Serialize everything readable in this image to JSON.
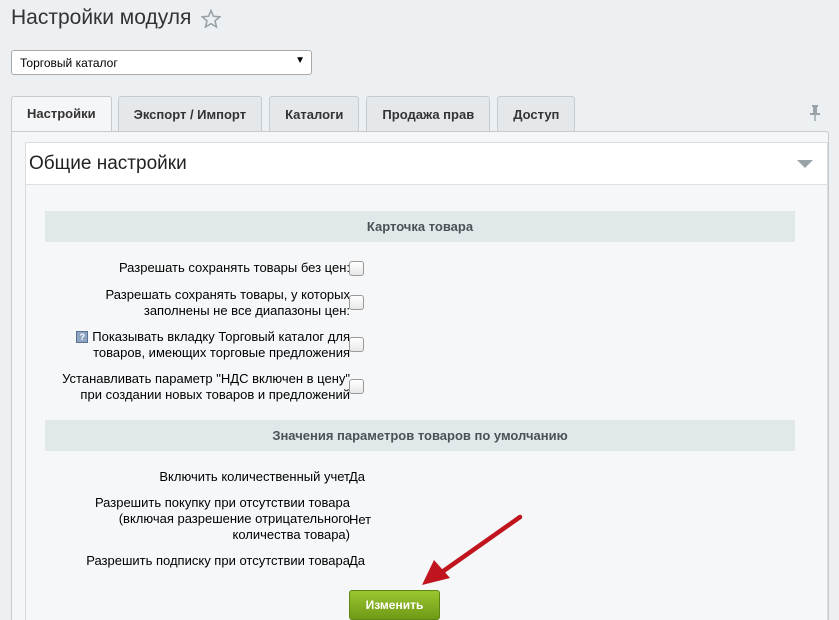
{
  "header": {
    "title": "Настройки модуля",
    "favorite_icon": "star-outline-icon"
  },
  "module_select": {
    "selected": "Торговый каталог"
  },
  "tabs": [
    {
      "label": "Настройки",
      "active": true
    },
    {
      "label": "Экспорт / Импорт",
      "active": false
    },
    {
      "label": "Каталоги",
      "active": false
    },
    {
      "label": "Продажа прав",
      "active": false
    },
    {
      "label": "Доступ",
      "active": false
    }
  ],
  "section": {
    "title": "Общие настройки"
  },
  "product_card": {
    "title": "Карточка товара",
    "rows": [
      {
        "label_lines": [
          "Разрешать сохранять товары без цен:"
        ],
        "checked": false
      },
      {
        "label_lines": [
          "Разрешать сохранять товары, у которых",
          "заполнены не все диапазоны цен:"
        ],
        "checked": false
      },
      {
        "label_lines": [
          "Показывать вкладку Торговый каталог для",
          "товаров, имеющих торговые предложения"
        ],
        "checked": false,
        "help": true
      },
      {
        "label_lines": [
          "Устанавливать параметр \"НДС включен в цену\"",
          "при создании новых товаров и предложений"
        ],
        "checked": false
      }
    ]
  },
  "defaults": {
    "title": "Значения параметров товаров по умолчанию",
    "rows": [
      {
        "label_lines": [
          "Включить количественный учет"
        ],
        "value": "Да"
      },
      {
        "label_lines": [
          "Разрешить покупку при отсутствии товара",
          "(включая разрешение отрицательного",
          "количества товара)"
        ],
        "value": "Нет"
      },
      {
        "label_lines": [
          "Разрешить подписку при отсутствии товара"
        ],
        "value": "Да"
      }
    ]
  },
  "buttons": {
    "change_label": "Изменить"
  },
  "colors": {
    "button_green": "#7eab1f",
    "annotation_arrow": "#c0141e"
  }
}
